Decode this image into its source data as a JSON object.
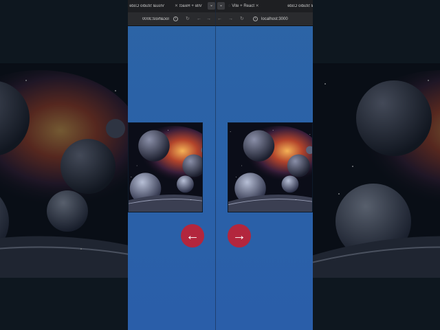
{
  "left_pane": {
    "tab_title": "Vite + React",
    "vscode_label": "Visual Studio Code",
    "url": "localhost:3000",
    "prev_button_label": "←",
    "mirrored": true
  },
  "right_pane": {
    "tab_title": "Vite + React",
    "vscode_label": "Visual Studio Code",
    "url": "localhost:3000",
    "next_button_label": "→"
  },
  "colors": {
    "page_background": "#2a61a8",
    "button_red": "#b3263d",
    "browser_chrome": "#1e1f22"
  },
  "icons": [
    "close-icon",
    "chevron-down-icon",
    "reload-icon",
    "back-icon",
    "forward-icon",
    "info-icon",
    "arrow-left-icon",
    "arrow-right-icon"
  ],
  "image_subject": "space planets galaxy artwork"
}
